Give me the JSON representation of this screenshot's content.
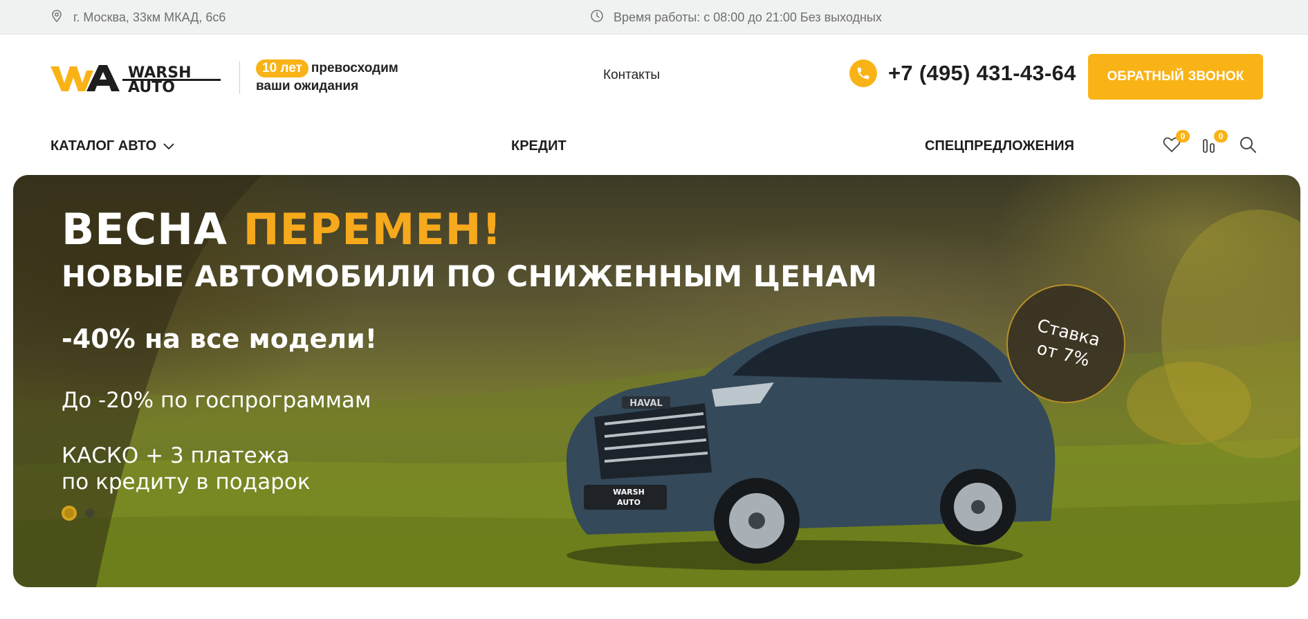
{
  "topbar": {
    "address": "г. Москва, 33км МКАД, 6с6",
    "hours": "Время работы: с 08:00 до 21:00 Без выходных"
  },
  "header": {
    "logo_text_top": "WARSH",
    "logo_text_bottom": "AUTO",
    "tagline_badge": "10 лет",
    "tagline_rest": "превосходим",
    "tagline_line2": "ваши ожидания",
    "contacts_link": "Контакты",
    "phone": "+7 (495) 431-43-64",
    "callback_button": "ОБРАТНЫЙ ЗВОНОК"
  },
  "menu": {
    "catalog": "КАТАЛОГ АВТО",
    "credit": "КРЕДИТ",
    "special": "СПЕЦПРЕДЛОЖЕНИЯ",
    "favorites_count": "0",
    "compare_count": "0"
  },
  "banner": {
    "title_white": "ВЕСНА ",
    "title_accent": "ПЕРЕМЕН!",
    "subtitle": "НОВЫЕ АВТОМОБИЛИ ПО СНИЖЕННЫМ ЦЕНАМ",
    "offer1": "-40% на все модели!",
    "offer2": "До -20% по госпрограммам",
    "offer3_line1": "КАСКО + 3 платежа",
    "offer3_line2": "по кредиту в подарок",
    "rate_line1": "Ставка",
    "rate_line2": "от 7%",
    "car_grille_badge": "HAVAL",
    "plate_text_top": "WARSH",
    "plate_text_bottom": "AUTO",
    "slides_total": 2,
    "active_slide": 1
  },
  "colors": {
    "accent": "#f9b316",
    "topbar_bg": "#f0f1f1",
    "text_dark": "#1e1e1e"
  }
}
